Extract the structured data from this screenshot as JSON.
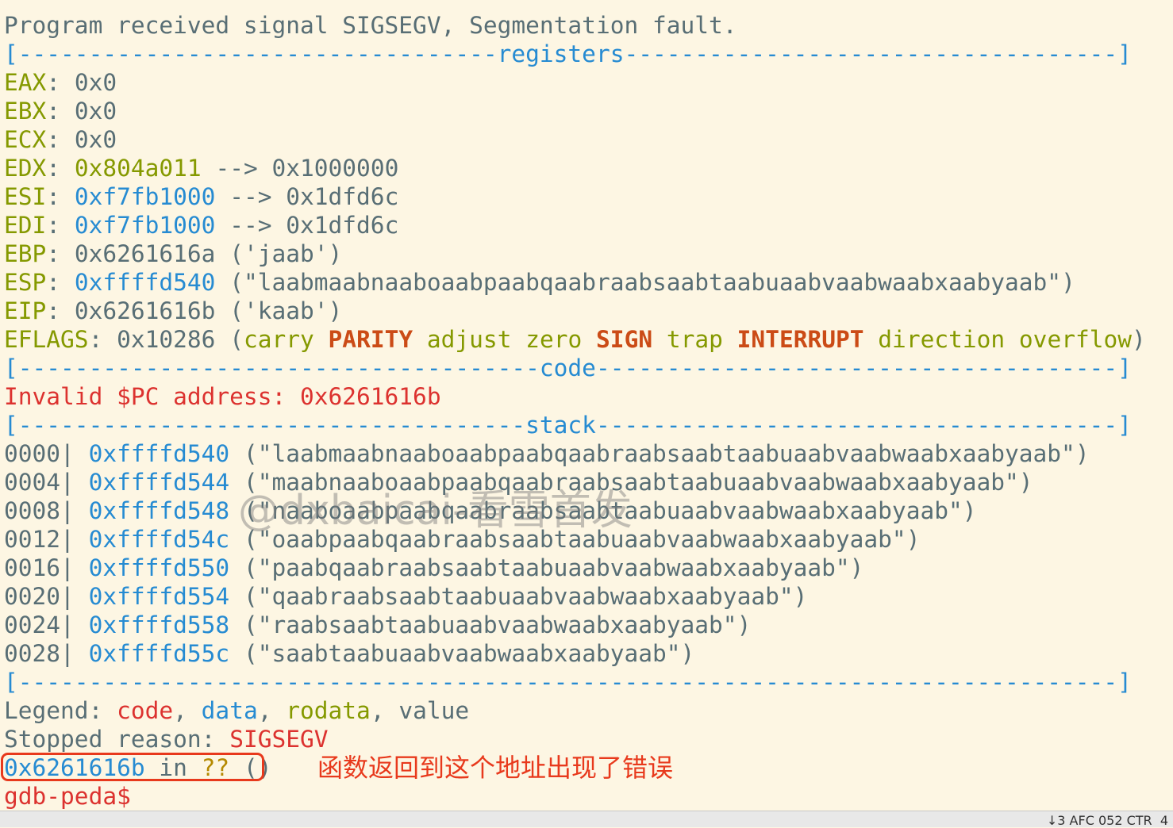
{
  "signal_msg": "Program received signal SIGSEGV, Segmentation fault.",
  "sections": {
    "registers": "registers",
    "code": "code",
    "stack": "stack"
  },
  "registers": [
    {
      "name": "EAX",
      "value": "0x0"
    },
    {
      "name": "EBX",
      "value": "0x0"
    },
    {
      "name": "ECX",
      "value": "0x0"
    },
    {
      "name": "EDX",
      "value": "0x804a011",
      "deref": "--> 0x1000000"
    },
    {
      "name": "ESI",
      "value": "0xf7fb1000",
      "deref": "--> 0x1dfd6c"
    },
    {
      "name": "EDI",
      "value": "0xf7fb1000",
      "deref": "--> 0x1dfd6c"
    },
    {
      "name": "EBP",
      "value": "0x6261616a",
      "deref": "('jaab')"
    },
    {
      "name": "ESP",
      "value": "0xffffd540",
      "deref": "(\"laabmaabnaaboaabpaabqaabraabsaabtaabuaabvaabwaabxaabyaab\")"
    },
    {
      "name": "EIP",
      "value": "0x6261616b",
      "deref": "('kaab')"
    }
  ],
  "eflags": {
    "name": "EFLAGS",
    "value": "0x10286",
    "flags": [
      {
        "label": "carry",
        "set": false
      },
      {
        "label": "PARITY",
        "set": true
      },
      {
        "label": "adjust",
        "set": false
      },
      {
        "label": "zero",
        "set": false
      },
      {
        "label": "SIGN",
        "set": true
      },
      {
        "label": "trap",
        "set": false
      },
      {
        "label": "INTERRUPT",
        "set": true
      },
      {
        "label": "direction",
        "set": false
      },
      {
        "label": "overflow",
        "set": false
      }
    ]
  },
  "code_error": "Invalid $PC address: 0x6261616b",
  "stack": [
    {
      "offset": "0000",
      "addr": "0xffffd540",
      "str": "(\"laabmaabnaaboaabpaabqaabraabsaabtaabuaabvaabwaabxaabyaab\")"
    },
    {
      "offset": "0004",
      "addr": "0xffffd544",
      "str": "(\"maabnaaboaabpaabqaabraabsaabtaabuaabvaabwaabxaabyaab\")"
    },
    {
      "offset": "0008",
      "addr": "0xffffd548",
      "str": "(\"naaboaabpaabqaabraabsaabtaabuaabvaabwaabxaabyaab\")"
    },
    {
      "offset": "0012",
      "addr": "0xffffd54c",
      "str": "(\"oaabpaabqaabraabsaabtaabuaabvaabwaabxaabyaab\")"
    },
    {
      "offset": "0016",
      "addr": "0xffffd550",
      "str": "(\"paabqaabraabsaabtaabuaabvaabwaabxaabyaab\")"
    },
    {
      "offset": "0020",
      "addr": "0xffffd554",
      "str": "(\"qaabraabsaabtaabuaabvaabwaabxaabyaab\")"
    },
    {
      "offset": "0024",
      "addr": "0xffffd558",
      "str": "(\"raabsaabtaabuaabvaabwaabxaabyaab\")"
    },
    {
      "offset": "0028",
      "addr": "0xffffd55c",
      "str": "(\"saabtaabuaabvaabwaabxaabyaab\")"
    }
  ],
  "legend": {
    "label": "Legend:",
    "code": "code",
    "data": "data",
    "rodata": "rodata",
    "value": "value"
  },
  "stopped": {
    "label": "Stopped reason:",
    "reason": "SIGSEGV"
  },
  "crash": {
    "addr": "0x6261616b",
    "in": "in",
    "qq": "??",
    "parens": "()"
  },
  "prompt": "gdb-peda$",
  "annotation": "函数返回到这个地址出现了错误",
  "watermark": "@dxbaicai-看雪首发",
  "statusbar": "↓3 AFC 052 CTR  4"
}
